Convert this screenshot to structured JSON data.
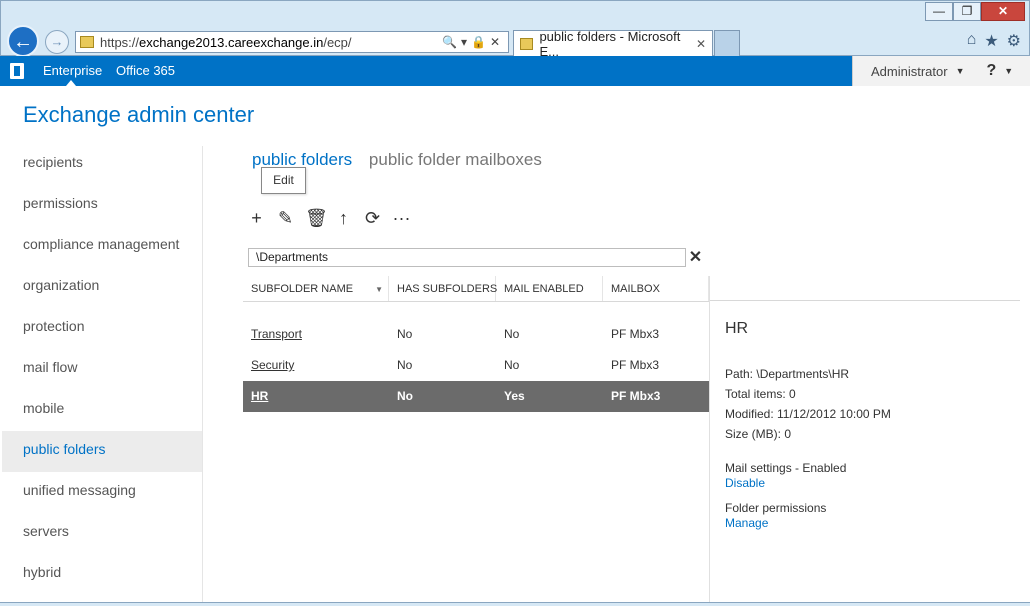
{
  "browser": {
    "url_prefix": "https://",
    "url_domain": "exchange2013.careexchange.in",
    "url_path": "/ecp/",
    "address_tools": "🔍▾🔒✕",
    "tab_title": "public folders - Microsoft E...",
    "tab_close": "✕",
    "window_buttons": [
      "—",
      "❐",
      "✕"
    ],
    "right_icons": [
      "⌂",
      "★",
      "⚙"
    ]
  },
  "topnav": {
    "enterprise": "Enterprise",
    "office365": "Office 365",
    "user": "Administrator",
    "help": "?"
  },
  "app_title": "Exchange admin center",
  "leftnav": {
    "items": [
      {
        "label": "recipients"
      },
      {
        "label": "permissions"
      },
      {
        "label": "compliance management"
      },
      {
        "label": "organization"
      },
      {
        "label": "protection"
      },
      {
        "label": "mail flow"
      },
      {
        "label": "mobile"
      },
      {
        "label": "public folders",
        "active": true
      },
      {
        "label": "unified messaging"
      },
      {
        "label": "servers"
      },
      {
        "label": "hybrid"
      }
    ]
  },
  "tabs": {
    "public_folders": "public folders",
    "public_folder_mailboxes": "public folder mailboxes"
  },
  "tooltip": "Edit",
  "toolbar": {
    "add": "+",
    "edit": "✎",
    "delete": "🗑",
    "up": "↑",
    "refresh": "⟳",
    "more": "···"
  },
  "path": {
    "value": "\\Departments",
    "clear": "✕"
  },
  "grid": {
    "headers": [
      "SUBFOLDER NAME",
      "HAS SUBFOLDERS",
      "MAIL ENABLED",
      "MAILBOX"
    ],
    "rows": [
      {
        "name": "Transport",
        "has_subfolders": "No",
        "mail_enabled": "No",
        "mailbox": "PF Mbx3"
      },
      {
        "name": "Security",
        "has_subfolders": "No",
        "mail_enabled": "No",
        "mailbox": "PF Mbx3"
      },
      {
        "name": "HR",
        "has_subfolders": "No",
        "mail_enabled": "Yes",
        "mailbox": "PF Mbx3"
      }
    ]
  },
  "detail": {
    "title": "HR",
    "path": "Path: \\Departments\\HR",
    "total_items": "Total items: 0",
    "modified": "Modified: 11/12/2012 10:00 PM",
    "size": "Size (MB): 0",
    "mail_settings": "Mail settings - Enabled",
    "disable": "Disable",
    "folder_permissions": "Folder permissions",
    "manage": "Manage"
  }
}
